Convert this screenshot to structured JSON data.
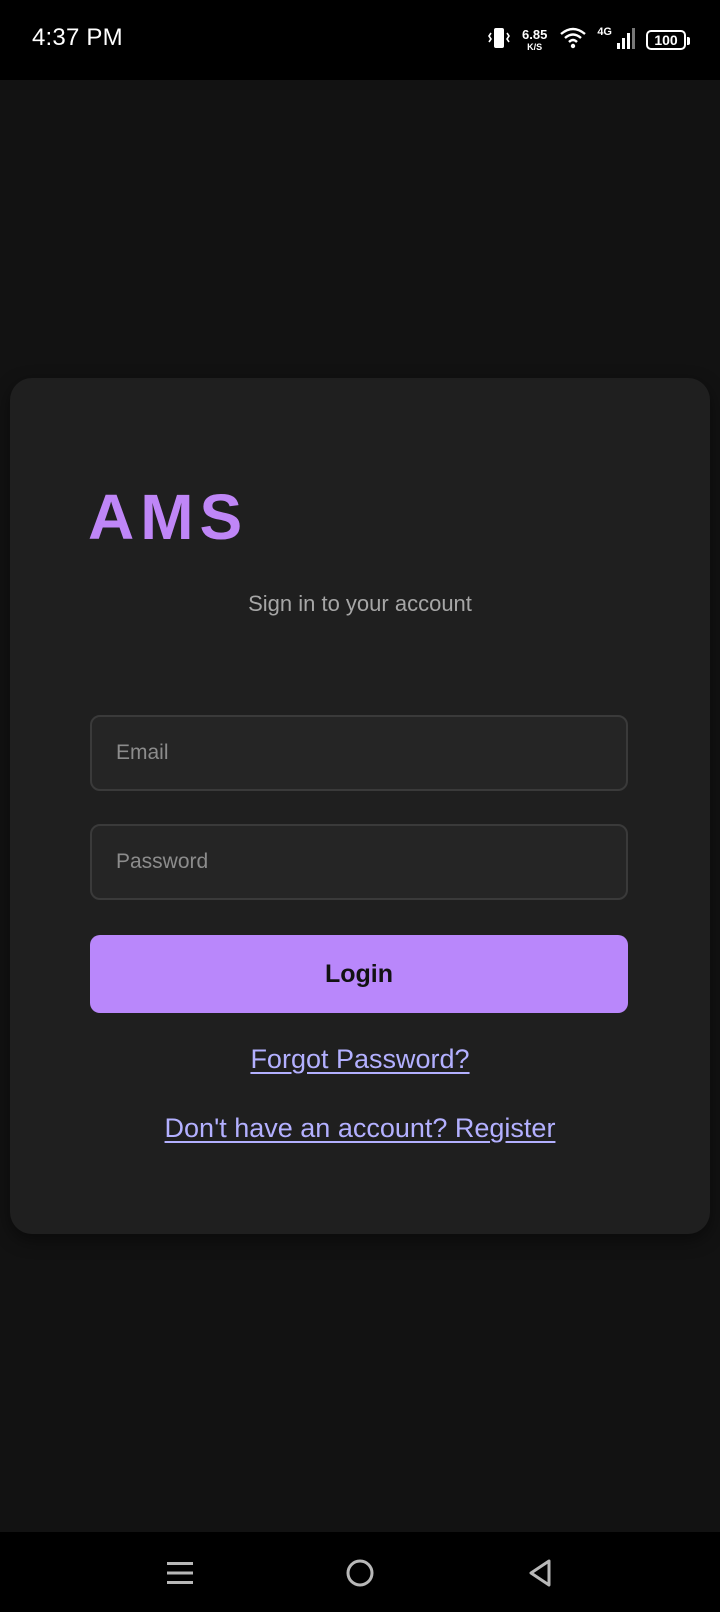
{
  "status_bar": {
    "time": "4:37 PM",
    "net_speed_value": "6.85",
    "net_speed_unit": "K/S",
    "network_type": "4G",
    "battery_level": "100",
    "icons": [
      "vibrate-icon",
      "wifi-icon",
      "cell-signal-icon",
      "battery-icon"
    ]
  },
  "login": {
    "brand": "AMS",
    "subtitle": "Sign in to your account",
    "email_placeholder": "Email",
    "password_placeholder": "Password",
    "login_label": "Login",
    "forgot_link": "Forgot Password?",
    "register_link": "Don't have an account? Register"
  },
  "nav_bar": {
    "icons": [
      "menu-icon",
      "home-icon",
      "back-icon"
    ]
  },
  "colors": {
    "accent": "#b987fb",
    "brand": "#bf86f7",
    "link": "#b3b0ff",
    "background": "#121212",
    "card": "#1f1f1f"
  }
}
